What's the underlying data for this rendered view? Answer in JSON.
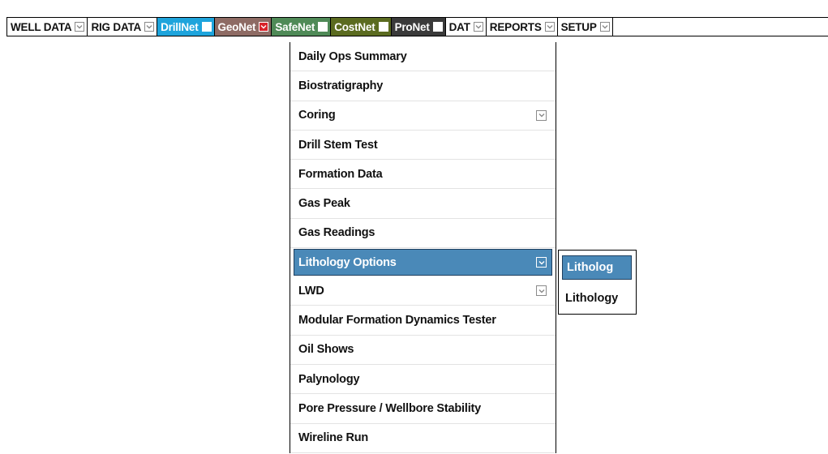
{
  "menubar": {
    "tabs": [
      {
        "label": "WELL DATA",
        "bg": "#ffffff",
        "dark": false
      },
      {
        "label": "RIG DATA",
        "bg": "#ffffff",
        "dark": false
      },
      {
        "label": "DrillNet",
        "bg": "#1ea4dc",
        "dark": true
      },
      {
        "label": "GeoNet",
        "bg": "#8e6b64",
        "dark": true
      },
      {
        "label": "SafeNet",
        "bg": "#4f8a57",
        "dark": true
      },
      {
        "label": "CostNet",
        "bg": "#5b6b20",
        "dark": true
      },
      {
        "label": "ProNet",
        "bg": "#3a3a3a",
        "dark": true
      },
      {
        "label": "DAT",
        "bg": "#ffffff",
        "dark": false
      },
      {
        "label": "REPORTS",
        "bg": "#ffffff",
        "dark": false
      },
      {
        "label": "SETUP",
        "bg": "#ffffff",
        "dark": false
      }
    ]
  },
  "dropdown": {
    "items": [
      {
        "label": "Daily Ops Summary",
        "has_submenu": false,
        "active": false
      },
      {
        "label": "Biostratigraphy",
        "has_submenu": false,
        "active": false
      },
      {
        "label": "Coring",
        "has_submenu": true,
        "active": false
      },
      {
        "label": "Drill Stem Test",
        "has_submenu": false,
        "active": false
      },
      {
        "label": "Formation Data",
        "has_submenu": false,
        "active": false
      },
      {
        "label": "Gas Peak",
        "has_submenu": false,
        "active": false
      },
      {
        "label": "Gas Readings",
        "has_submenu": false,
        "active": false
      },
      {
        "label": "Lithology Options",
        "has_submenu": true,
        "active": true
      },
      {
        "label": "LWD",
        "has_submenu": true,
        "active": false
      },
      {
        "label": "Modular Formation Dynamics Tester",
        "has_submenu": false,
        "active": false
      },
      {
        "label": "Oil Shows",
        "has_submenu": false,
        "active": false
      },
      {
        "label": "Palynology",
        "has_submenu": false,
        "active": false
      },
      {
        "label": "Pore Pressure / Wellbore Stability",
        "has_submenu": false,
        "active": false
      },
      {
        "label": "Wireline Run",
        "has_submenu": false,
        "active": false
      }
    ]
  },
  "submenu": {
    "items": [
      {
        "label": "Litholog",
        "active": true
      },
      {
        "label": "Lithology",
        "active": false
      }
    ]
  },
  "colors": {
    "highlight": "#4a89b8",
    "geonet_chevron": "#d9242b"
  },
  "icons": {
    "dropdown_arrow": "chevron-down-icon"
  }
}
